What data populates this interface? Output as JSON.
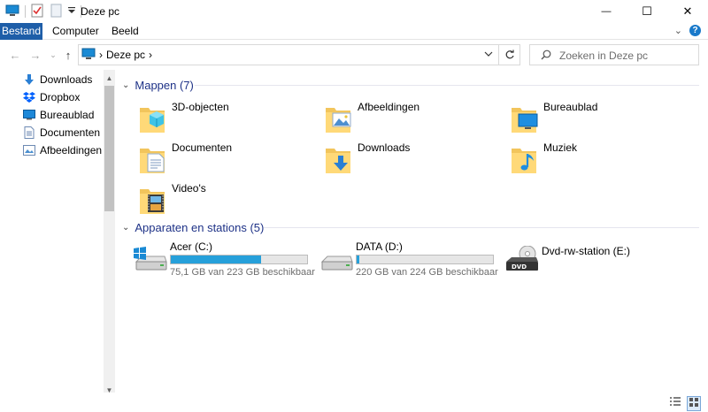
{
  "window": {
    "title": "Deze pc",
    "minimize_glyph": "—",
    "maximize_glyph": "☐",
    "close_glyph": "✕"
  },
  "ribbon": {
    "tabs": [
      "Bestand",
      "Computer",
      "Beeld"
    ],
    "accent": "#1e5ea8"
  },
  "nav": {
    "back": "←",
    "forward": "→",
    "recent": "⌄",
    "up": "↑",
    "crumb_sep": "›",
    "path": "Deze pc",
    "search_placeholder": "Zoeken in Deze pc"
  },
  "sidebar": {
    "items": [
      {
        "label": "Downloads",
        "icon": "download-icon"
      },
      {
        "label": "Dropbox",
        "icon": "dropbox-icon"
      },
      {
        "label": "Bureaublad",
        "icon": "desktop-icon"
      },
      {
        "label": "Documenten",
        "icon": "document-icon"
      },
      {
        "label": "Afbeeldingen",
        "icon": "pictures-icon"
      }
    ]
  },
  "folders": {
    "header": "Mappen (7)",
    "items": [
      {
        "label": "3D-objecten",
        "icon": "3d-objects-icon"
      },
      {
        "label": "Afbeeldingen",
        "icon": "pictures-folder-icon"
      },
      {
        "label": "Bureaublad",
        "icon": "desktop-folder-icon"
      },
      {
        "label": "Documenten",
        "icon": "documents-folder-icon"
      },
      {
        "label": "Downloads",
        "icon": "downloads-folder-icon"
      },
      {
        "label": "Muziek",
        "icon": "music-folder-icon"
      },
      {
        "label": "Video's",
        "icon": "videos-folder-icon"
      }
    ]
  },
  "drives": {
    "header": "Apparaten en stations (5)",
    "items": [
      {
        "label": "Acer (C:)",
        "free": "75,1 GB van 223 GB beschikbaar",
        "used_fraction": 0.66,
        "icon": "windows-drive-icon"
      },
      {
        "label": "DATA (D:)",
        "free": "220 GB van 224 GB beschikbaar",
        "used_fraction": 0.02,
        "icon": "hard-drive-icon"
      },
      {
        "label": "Dvd-rw-station (E:)",
        "free": "",
        "icon": "dvd-drive-icon"
      }
    ]
  }
}
